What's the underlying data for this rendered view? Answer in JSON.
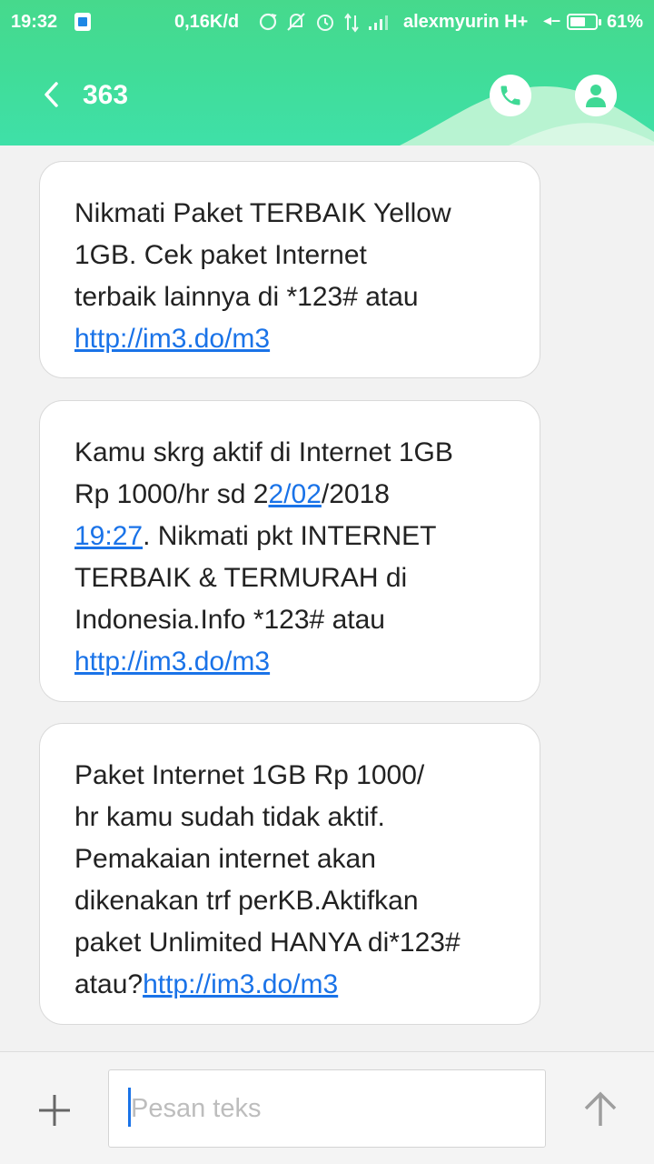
{
  "status_bar": {
    "time": "19:32",
    "speed": "0,16K/d",
    "carrier": "alexmyurin H+",
    "battery_percent": "61%",
    "battery_level": 0.61,
    "icons": [
      "sim-notification-icon",
      "sync-icon",
      "alarm-off-icon",
      "alarm-icon",
      "data-signal-icon",
      "cell-signal-icon",
      "battery-icon"
    ]
  },
  "header": {
    "title": "363",
    "icons": [
      "back-arrow-icon",
      "phone-icon",
      "person-icon"
    ],
    "accent_color": "#46d98c"
  },
  "messages": [
    {
      "lines": [
        [
          {
            "t": "Nikmati Paket TERBAIK Yellow"
          }
        ],
        [
          {
            "t": "1GB.  Cek paket Internet"
          }
        ],
        [
          {
            "t": "terbaik lainnya di *123# atau"
          }
        ],
        [
          {
            "t": "http://im3.do/m3",
            "link": true
          }
        ]
      ]
    },
    {
      "lines": [
        [
          {
            "t": "Kamu skrg aktif di Internet 1GB"
          }
        ],
        [
          {
            "t": "Rp 1000/hr sd 2"
          },
          {
            "t": "2/02",
            "link": true
          },
          {
            "t": "/2018"
          }
        ],
        [
          {
            "t": "19:27",
            "link": true
          },
          {
            "t": ". Nikmati pkt INTERNET"
          }
        ],
        [
          {
            "t": "TERBAIK & TERMURAH di"
          }
        ],
        [
          {
            "t": "Indonesia.Info *123# atau"
          }
        ],
        [
          {
            "t": "http://im3.do/m3",
            "link": true
          }
        ]
      ]
    },
    {
      "lines": [
        [
          {
            "t": "Paket Internet 1GB Rp 1000/"
          }
        ],
        [
          {
            "t": "hr kamu sudah tidak aktif."
          }
        ],
        [
          {
            "t": "Pemakaian internet akan"
          }
        ],
        [
          {
            "t": "dikenakan trf perKB.Aktifkan"
          }
        ],
        [
          {
            "t": "paket Unlimited HANYA di*123#"
          }
        ],
        [
          {
            "t": "atau?"
          },
          {
            "t": "http://im3.do/m3",
            "link": true
          }
        ]
      ]
    }
  ],
  "composer": {
    "placeholder": "Pesan teks",
    "value": "",
    "icons": [
      "plus-icon",
      "send-arrow-icon"
    ],
    "link_color": "#1a73e8"
  }
}
